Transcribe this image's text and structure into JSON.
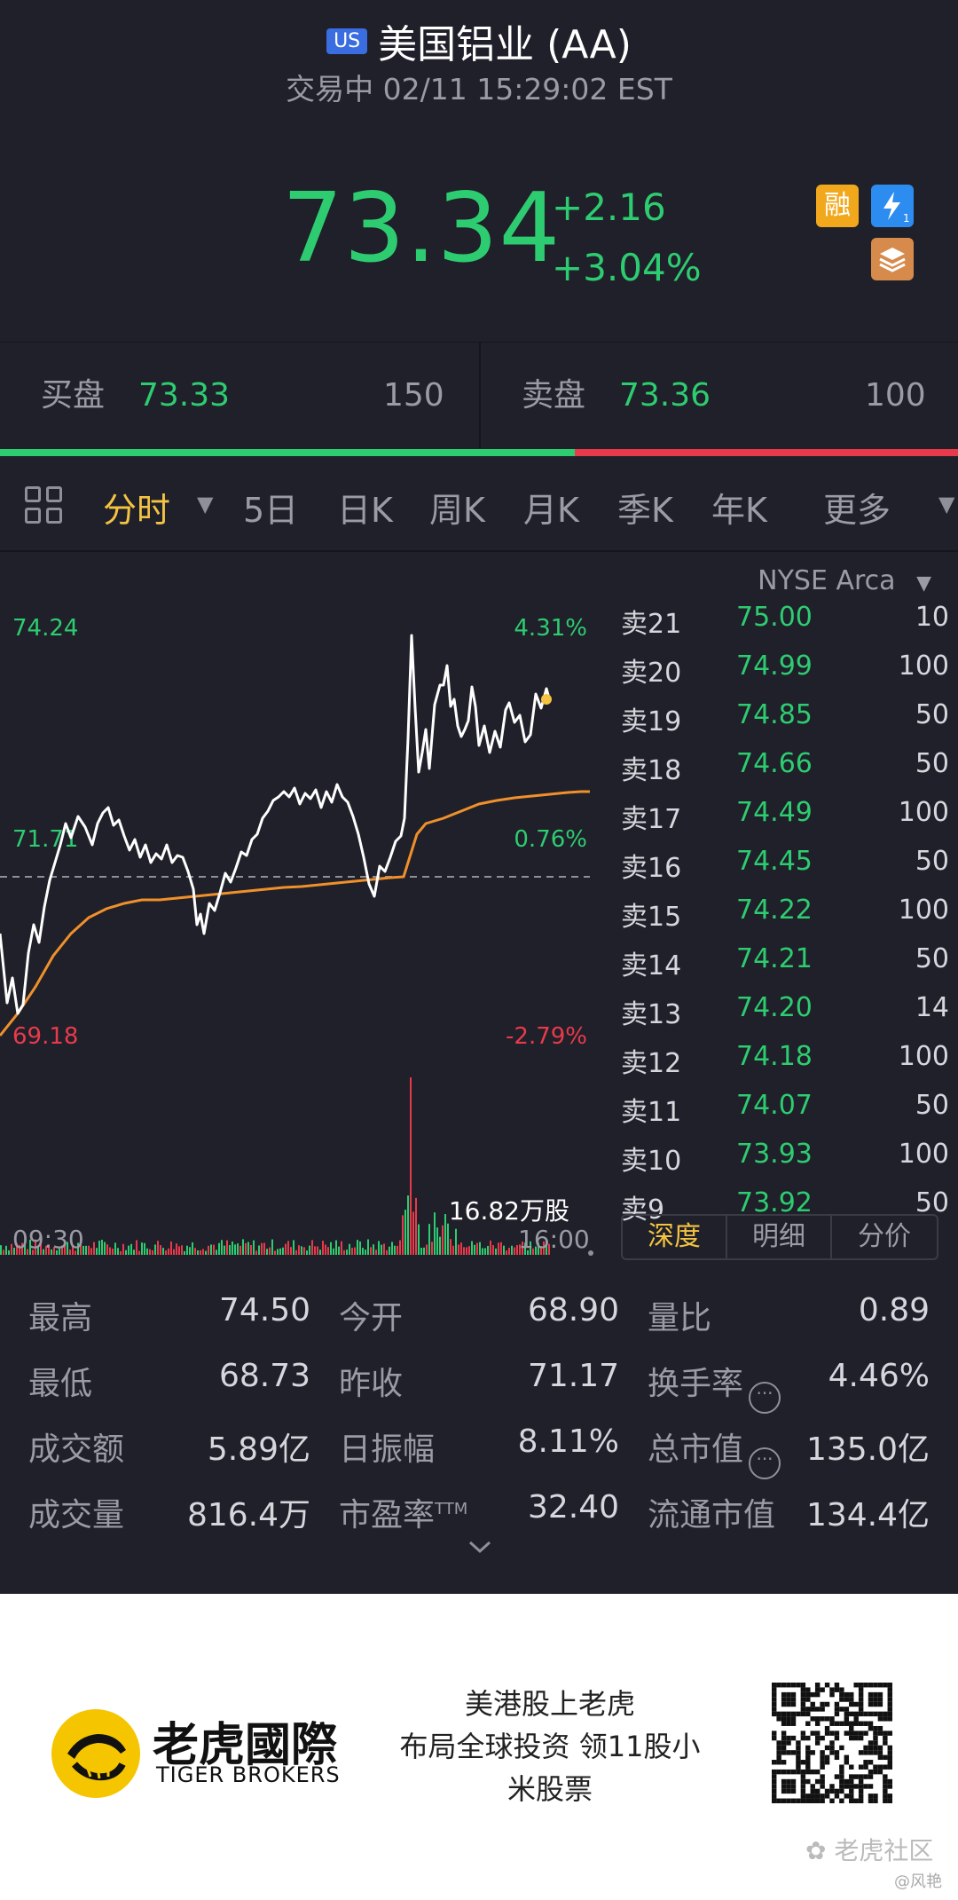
{
  "header": {
    "market_badge": "US",
    "title": "美国铝业 (AA)",
    "status_time": "交易中 02/11 15:29:02 EST",
    "price": "73.34",
    "change": "+2.16",
    "change_pct": "+3.04%",
    "badges": {
      "margin": "融",
      "flash_icon": "flash-icon",
      "layers_icon": "layers-icon"
    }
  },
  "bid_ask": {
    "bid_label": "买盘",
    "bid_price": "73.33",
    "bid_volume": "150",
    "ask_label": "卖盘",
    "ask_price": "73.36",
    "ask_volume": "100",
    "bid_ratio": 0.6
  },
  "tabs": [
    "分时",
    "5日",
    "日K",
    "周K",
    "月K",
    "季K",
    "年K",
    "更多"
  ],
  "active_tab": "分时",
  "chart": {
    "high_price": "74.24",
    "high_pct": "4.31%",
    "mid_price": "71.71",
    "mid_pct": "0.76%",
    "low_price": "69.18",
    "low_pct": "-2.79%",
    "volume_label": "16.82万股",
    "time_start": "09:30",
    "time_end": "16:00",
    "colors": {
      "price_line": "#ffffff",
      "avg_line": "#f0902b",
      "up": "#2ecc71",
      "down": "#e93a4b"
    }
  },
  "order_book": {
    "exchange": "NYSE Arca",
    "rows": [
      {
        "label": "卖21",
        "price": "75.00",
        "volume": "10"
      },
      {
        "label": "卖20",
        "price": "74.99",
        "volume": "100"
      },
      {
        "label": "卖19",
        "price": "74.85",
        "volume": "50"
      },
      {
        "label": "卖18",
        "price": "74.66",
        "volume": "50"
      },
      {
        "label": "卖17",
        "price": "74.49",
        "volume": "100"
      },
      {
        "label": "卖16",
        "price": "74.45",
        "volume": "50"
      },
      {
        "label": "卖15",
        "price": "74.22",
        "volume": "100"
      },
      {
        "label": "卖14",
        "price": "74.21",
        "volume": "50"
      },
      {
        "label": "卖13",
        "price": "74.20",
        "volume": "14"
      },
      {
        "label": "卖12",
        "price": "74.18",
        "volume": "100"
      },
      {
        "label": "卖11",
        "price": "74.07",
        "volume": "50"
      },
      {
        "label": "卖10",
        "price": "73.93",
        "volume": "100"
      },
      {
        "label": "卖9",
        "price": "73.92",
        "volume": "50"
      }
    ],
    "tabs": [
      "深度",
      "明细",
      "分价"
    ],
    "active_tab": "深度"
  },
  "stats": {
    "high_label": "最高",
    "high": "74.50",
    "open_label": "今开",
    "open": "68.90",
    "vol_ratio_label": "量比",
    "vol_ratio": "0.89",
    "low_label": "最低",
    "low": "68.73",
    "prev_close_label": "昨收",
    "prev_close": "71.17",
    "turnover_rate_label": "换手率",
    "turnover_rate": "4.46%",
    "amount_label": "成交额",
    "amount": "5.89亿",
    "amplitude_label": "日振幅",
    "amplitude": "8.11%",
    "mkt_cap_label": "总市值",
    "mkt_cap": "135.0亿",
    "volume_label": "成交量",
    "volume": "816.4万",
    "pe_label": "市盈率",
    "pe_sup": "TTM",
    "pe": "32.40",
    "float_cap_label": "流通市值",
    "float_cap": "134.4亿"
  },
  "promo": {
    "brand_cn": "老虎國際",
    "brand_en": "TIGER BROKERS",
    "slogan_line1": "美港股上老虎",
    "slogan_line2": "布局全球投资 领11股小",
    "slogan_line3": "米股票",
    "watermark": "老虎社区",
    "watermark_user": "@风艳"
  }
}
